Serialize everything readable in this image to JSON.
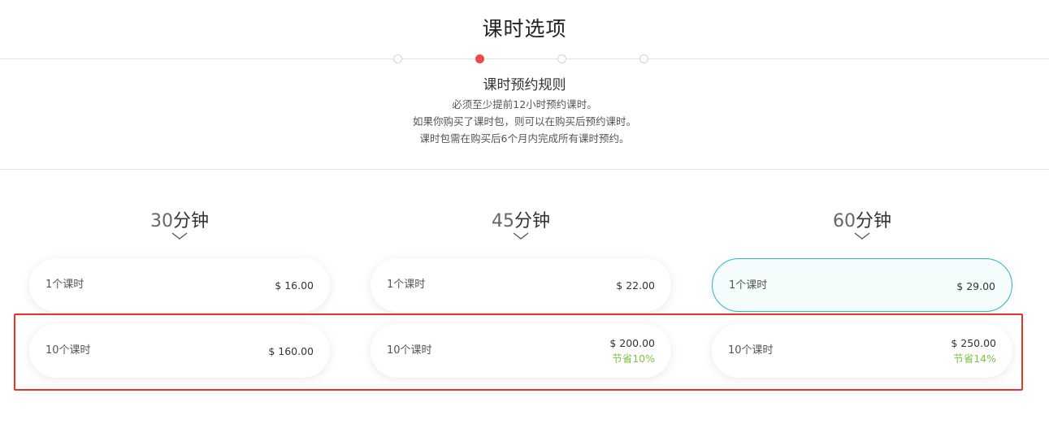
{
  "header": {
    "title": "课时选项"
  },
  "steps": {
    "active_index": 1,
    "count": 4
  },
  "rules": {
    "title": "课时预约规则",
    "lines": [
      "必须至少提前12小时预约课时。",
      "如果你购买了课时包，则可以在购买后预约课时。",
      "课时包需在购买后6个月内完成所有课时预约。"
    ]
  },
  "columns": [
    {
      "duration_num": "30",
      "duration_unit": "分钟",
      "options": [
        {
          "label": "1个课时",
          "price": "$ 16.00",
          "save": ""
        },
        {
          "label": "10个课时",
          "price": "$ 160.00",
          "save": ""
        }
      ]
    },
    {
      "duration_num": "45",
      "duration_unit": "分钟",
      "options": [
        {
          "label": "1个课时",
          "price": "$ 22.00",
          "save": ""
        },
        {
          "label": "10个课时",
          "price": "$ 200.00",
          "save": "节省10%"
        }
      ]
    },
    {
      "duration_num": "60",
      "duration_unit": "分钟",
      "options": [
        {
          "label": "1个课时",
          "price": "$ 29.00",
          "save": ""
        },
        {
          "label": "10个课时",
          "price": "$ 250.00",
          "save": "节省14%"
        }
      ]
    }
  ],
  "colors": {
    "accent_selected": "#2ab8c2",
    "step_active": "#f04848",
    "save_green": "#7cc443",
    "highlight_red": "#e8332a"
  }
}
